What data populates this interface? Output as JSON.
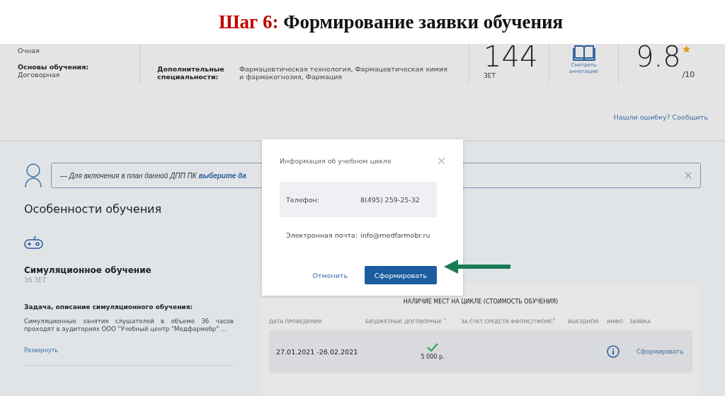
{
  "slide_title": {
    "step": "Шаг 6:",
    "text": "Формирование заявки обучения"
  },
  "summary": {
    "form_value": "Очная",
    "basis_label": "Основы обучения:",
    "basis_value": "Договорная",
    "extra_label": "Дополнительные специальности:",
    "extra_value": "Фармацевтическая технология, Фармацевтическая химия и фармакогнозия, Фармация",
    "credits": "144",
    "credits_unit": "ЗЕТ",
    "annotation_link": "Смотреть аннотацию",
    "rating": "9.8",
    "rating_scale": "/10",
    "report_link": "Нашли ошибку? Сообщить"
  },
  "hint": {
    "text": "— Для включения в план данной ДПП ПК",
    "link": "выберите да"
  },
  "features": {
    "heading": "Особенности обучения",
    "title": "Симуляционное обучение",
    "credits": "36 ЗЕТ",
    "task_label": "Задача, описание симуляционного обучения:",
    "description": "Симуляционные занятия слушателей в объеме 36 часов проходят в аудиториях ООО \"Учебный центр \"Медфармобр\" ...",
    "expand_link": "Развернуть"
  },
  "schedule": {
    "caption": "НАЛИЧИЕ МЕСТ НА ЦИКЛЕ (СТОИМОСТЬ ОБУЧЕНИЯ)",
    "columns": [
      "ДАТА ПРОВЕДЕНИЯ",
      "БЮДЖЕТНЫЕ",
      "ДОГОВОРНЫЕ $^{*}$",
      "ЗА СЧЕТ СРЕДСТВ ФФОМС/ТФОМС$^{*}$",
      "ВЫЕЗДНОЙ",
      "ИНФО",
      "ЗАЯВКА"
    ],
    "rows": [
      {
        "date": "27.01.2021 -26.02.2021",
        "contract_available": true,
        "contract_price": "5 000 р.",
        "action": "Сформировать"
      }
    ]
  },
  "modal": {
    "title": "Информация об учебном цикле",
    "fields": [
      {
        "label": "Телефон:",
        "value": "8(495) 259-25-32"
      },
      {
        "label": "Электронная почта:",
        "value": "info@medfarmobr.ru"
      }
    ],
    "cancel": "Отменить",
    "submit": "Сформировать"
  }
}
